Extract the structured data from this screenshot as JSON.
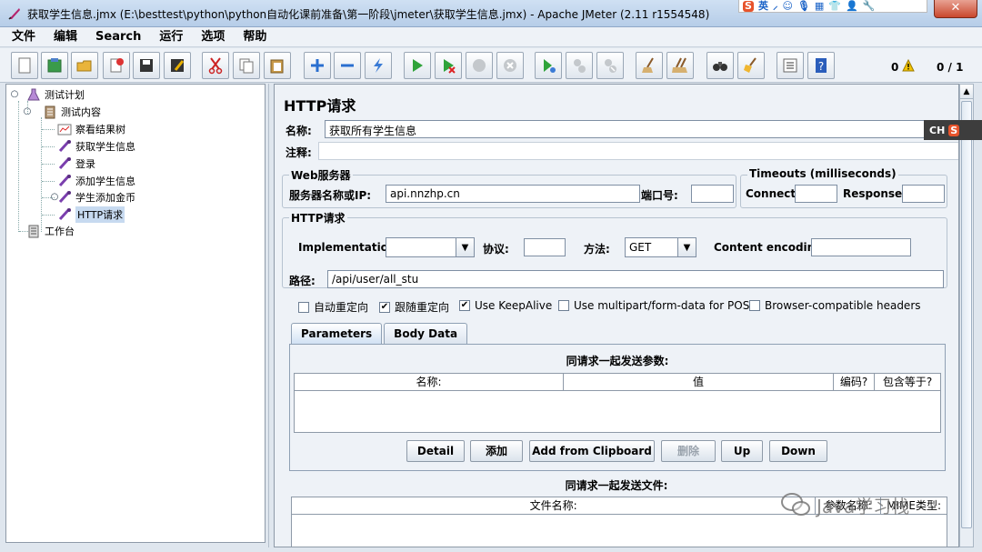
{
  "window": {
    "title": "获取学生信息.jmx (E:\\besttest\\python\\python自动化课前准备\\第一阶段\\jmeter\\获取学生信息.jmx) - Apache JMeter (2.11 r1554548)",
    "close_label": "✕",
    "tray": [
      "S",
      "英",
      "⸝",
      "☺",
      "🎙",
      "▦",
      "👕",
      "👤",
      "🔧"
    ]
  },
  "menu": [
    "文件",
    "编辑",
    "Search",
    "运行",
    "选项",
    "帮助"
  ],
  "toolbar": {
    "buttons": [
      {
        "name": "new-icon"
      },
      {
        "name": "templates-icon"
      },
      {
        "name": "open-icon"
      },
      {
        "name": "close-icon"
      },
      {
        "name": "save-icon"
      },
      {
        "name": "save-as-icon"
      },
      {
        "name": "cut-icon"
      },
      {
        "name": "copy-icon"
      },
      {
        "name": "paste-icon"
      },
      {
        "name": "expand-icon"
      },
      {
        "name": "collapse-icon"
      },
      {
        "name": "toggle-icon"
      },
      {
        "name": "start-icon"
      },
      {
        "name": "start-no-pause-icon"
      },
      {
        "name": "stop-icon"
      },
      {
        "name": "shutdown-icon"
      },
      {
        "name": "remote-start-icon"
      },
      {
        "name": "remote-stop-icon"
      },
      {
        "name": "remote-shutdown-icon"
      },
      {
        "name": "clear-icon"
      },
      {
        "name": "clear-all-icon"
      },
      {
        "name": "search-icon"
      },
      {
        "name": "reset-search-icon"
      },
      {
        "name": "function-helper-icon"
      },
      {
        "name": "help-icon"
      }
    ],
    "error_count": "0",
    "threads": "0 / 1"
  },
  "tree": {
    "nodes": [
      {
        "label": "测试计划",
        "icon": "test-plan-icon"
      },
      {
        "label": "测试内容",
        "icon": "thread-group-icon"
      },
      {
        "label": "察看结果树",
        "icon": "listener-icon"
      },
      {
        "label": "获取学生信息",
        "icon": "sampler-icon"
      },
      {
        "label": "登录",
        "icon": "sampler-icon"
      },
      {
        "label": "添加学生信息",
        "icon": "sampler-icon"
      },
      {
        "label": "学生添加金币",
        "icon": "sampler-icon"
      },
      {
        "label": "HTTP请求",
        "icon": "sampler-icon"
      },
      {
        "label": "工作台",
        "icon": "workbench-icon"
      }
    ],
    "selected": 7
  },
  "panel": {
    "title": "HTTP请求",
    "name_label": "名称:",
    "name_value": "获取所有学生信息",
    "comment_label": "注释:",
    "comment_value": "",
    "web_server": {
      "group_title": "Web服务器",
      "server_label": "服务器名称或IP:",
      "server_value": "api.nnzhp.cn",
      "port_label": "端口号:",
      "port_value": ""
    },
    "timeouts": {
      "group_title": "Timeouts (milliseconds)",
      "connect_label": "Connect:",
      "connect_value": "",
      "response_label": "Response:",
      "response_value": ""
    },
    "http_request": {
      "group_title": "HTTP请求",
      "impl_label": "Implementation:",
      "impl_value": "",
      "protocol_label": "协议:",
      "protocol_value": "",
      "method_label": "方法:",
      "method_value": "GET",
      "encoding_label": "Content encoding:",
      "encoding_value": "",
      "path_label": "路径:",
      "path_value": "/api/user/all_stu"
    },
    "options": [
      {
        "label": "自动重定向",
        "checked": false
      },
      {
        "label": "跟随重定向",
        "checked": true
      },
      {
        "label": "Use KeepAlive",
        "checked": true
      },
      {
        "label": "Use multipart/form-data for POST",
        "checked": false
      },
      {
        "label": "Browser-compatible headers",
        "checked": false
      }
    ],
    "tabs": [
      "Parameters",
      "Body Data"
    ],
    "params": {
      "caption": "同请求一起发送参数:",
      "columns": [
        "名称:",
        "值",
        "编码?",
        "包含等于?"
      ]
    },
    "buttons": [
      "Detail",
      "添加",
      "Add from Clipboard",
      "删除",
      "Up",
      "Down"
    ],
    "files": {
      "caption": "同请求一起发送文件:",
      "columns": [
        "文件名称:",
        "参数名称:",
        "MIME类型:"
      ]
    }
  },
  "ime": {
    "ch": "CH",
    "s": "S"
  },
  "watermark": "Java学习栈"
}
